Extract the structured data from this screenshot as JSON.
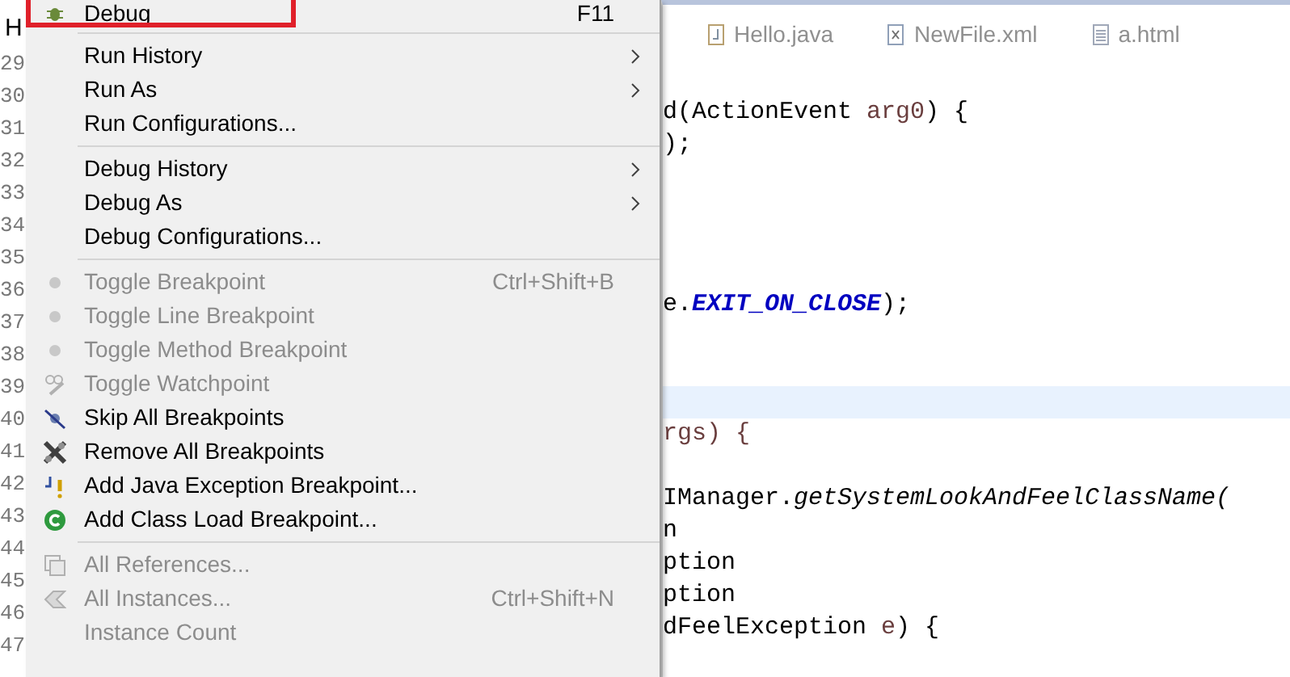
{
  "editor": {
    "tab_fragment": "H",
    "line_numbers": [
      "29",
      "30",
      "31",
      "32",
      "33",
      "34",
      "35",
      "36",
      "37",
      "38",
      "39",
      "40",
      "41",
      "42",
      "43",
      "44",
      "45",
      "46",
      "47"
    ],
    "tabs": [
      {
        "label": "Hello.java",
        "kind": "java"
      },
      {
        "label": "NewFile.xml",
        "kind": "xml"
      },
      {
        "label": "a.html",
        "kind": "file"
      }
    ],
    "code_lines": [
      {
        "kind": "blank"
      },
      {
        "kind": "code",
        "segments": [
          {
            "text": "d(ActionEvent ",
            "kind": "plain"
          },
          {
            "text": "arg0",
            "kind": "param"
          },
          {
            "text": ") {",
            "kind": "plain"
          }
        ]
      },
      {
        "kind": "code",
        "segments": [
          {
            "text": ");",
            "kind": "plain"
          }
        ]
      },
      {
        "kind": "blank"
      },
      {
        "kind": "blank"
      },
      {
        "kind": "blank"
      },
      {
        "kind": "blank"
      },
      {
        "kind": "code",
        "segments": [
          {
            "text": "e.",
            "kind": "plain"
          },
          {
            "text": "EXIT_ON_CLOSE",
            "kind": "constant"
          },
          {
            "text": ");",
            "kind": "plain"
          }
        ]
      },
      {
        "kind": "blank"
      },
      {
        "kind": "blank"
      },
      {
        "kind": "current"
      },
      {
        "kind": "code",
        "segments": [
          {
            "text": "rgs) {",
            "kind": "param"
          }
        ]
      },
      {
        "kind": "blank"
      },
      {
        "kind": "code",
        "segments": [
          {
            "text": "IManager.",
            "kind": "plain"
          },
          {
            "text": "getSystemLookAndFeelClassName(",
            "kind": "static"
          }
        ]
      },
      {
        "kind": "code",
        "segments": [
          {
            "text": "n",
            "kind": "plain"
          }
        ]
      },
      {
        "kind": "code",
        "segments": [
          {
            "text": "ption",
            "kind": "plain"
          }
        ]
      },
      {
        "kind": "code",
        "segments": [
          {
            "text": "ption",
            "kind": "plain"
          }
        ]
      },
      {
        "kind": "code",
        "segments": [
          {
            "text": "dFeelException ",
            "kind": "plain"
          },
          {
            "text": "e",
            "kind": "param"
          },
          {
            "text": ") {",
            "kind": "plain"
          }
        ]
      },
      {
        "kind": "blank"
      }
    ]
  },
  "menu": {
    "groups": [
      {
        "items": [
          {
            "label": "Debug",
            "shortcut": "F11",
            "kind": "bug",
            "disabled": false,
            "submenu": false,
            "highlighted": true
          }
        ]
      },
      {
        "items": [
          {
            "label": "Run History",
            "kind": "plain",
            "disabled": false,
            "submenu": true,
            "highlighted": false
          },
          {
            "label": "Run As",
            "kind": "plain",
            "disabled": false,
            "submenu": true,
            "highlighted": false
          },
          {
            "label": "Run Configurations...",
            "kind": "plain",
            "disabled": false,
            "submenu": false,
            "highlighted": false
          }
        ]
      },
      {
        "items": [
          {
            "label": "Debug History",
            "kind": "plain",
            "disabled": false,
            "submenu": true,
            "highlighted": false
          },
          {
            "label": "Debug As",
            "kind": "plain",
            "disabled": false,
            "submenu": true,
            "highlighted": false
          },
          {
            "label": "Debug Configurations...",
            "kind": "plain",
            "disabled": false,
            "submenu": false,
            "highlighted": false
          }
        ]
      },
      {
        "items": [
          {
            "label": "Toggle Breakpoint",
            "shortcut": "Ctrl+Shift+B",
            "kind": "dot",
            "disabled": true,
            "submenu": false,
            "highlighted": false
          },
          {
            "label": "Toggle Line Breakpoint",
            "kind": "dot",
            "disabled": true,
            "submenu": false,
            "highlighted": false
          },
          {
            "label": "Toggle Method Breakpoint",
            "kind": "dot",
            "disabled": true,
            "submenu": false,
            "highlighted": false
          },
          {
            "label": "Toggle Watchpoint",
            "kind": "watch",
            "disabled": true,
            "submenu": false,
            "highlighted": false
          },
          {
            "label": "Skip All Breakpoints",
            "kind": "skip",
            "disabled": false,
            "submenu": false,
            "highlighted": false
          },
          {
            "label": "Remove All Breakpoints",
            "kind": "remove",
            "disabled": false,
            "submenu": false,
            "highlighted": false
          },
          {
            "label": "Add Java Exception Breakpoint...",
            "kind": "exception",
            "disabled": false,
            "submenu": false,
            "highlighted": false
          },
          {
            "label": "Add Class Load Breakpoint...",
            "kind": "class",
            "disabled": false,
            "submenu": false,
            "highlighted": false
          }
        ]
      },
      {
        "items": [
          {
            "label": "All References...",
            "kind": "refs",
            "disabled": true,
            "submenu": false,
            "highlighted": false
          },
          {
            "label": "All Instances...",
            "shortcut": "Ctrl+Shift+N",
            "kind": "instances",
            "disabled": true,
            "submenu": false,
            "highlighted": false
          },
          {
            "label": "Instance Count",
            "kind": "plain",
            "disabled": true,
            "submenu": false,
            "highlighted": false
          }
        ]
      }
    ]
  }
}
